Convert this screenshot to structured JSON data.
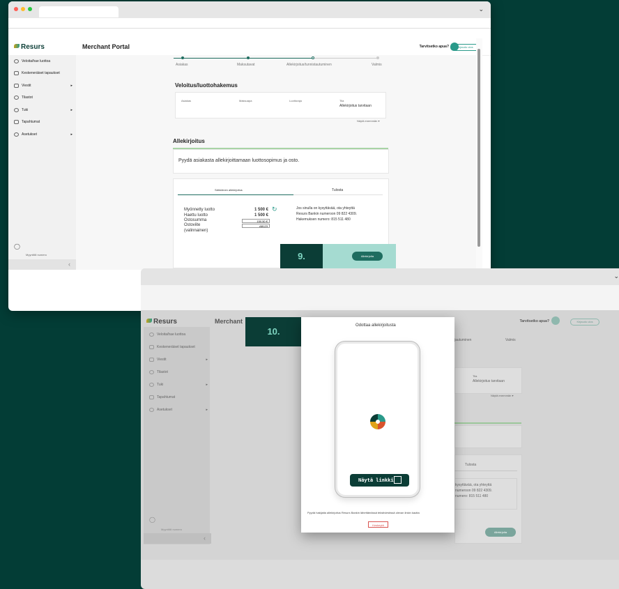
{
  "window1": {
    "brand": "Resurs",
    "portal_title": "Merchant Portal",
    "help_text": "Tarvitsetko apua?",
    "logout_label": "Kirjaudu ulos",
    "sidebar": {
      "items": [
        {
          "label": "Veloita/hae luottoa",
          "icon": "circle-icon",
          "arrow": ""
        },
        {
          "label": "Keskeneräiset tapaukset",
          "icon": "document-icon",
          "arrow": ""
        },
        {
          "label": "Viestit",
          "icon": "mail-icon",
          "arrow": "▸"
        },
        {
          "label": "Tilastot",
          "icon": "chart-icon",
          "arrow": ""
        },
        {
          "label": "Tuki",
          "icon": "chat-icon",
          "arrow": "▸"
        },
        {
          "label": "Tapahtumat",
          "icon": "building-icon",
          "arrow": ""
        },
        {
          "label": "Asetukset",
          "icon": "gear-icon",
          "arrow": "▸"
        }
      ],
      "profile_label": "Myyntitili numero"
    },
    "steps": [
      "Asiakas",
      "Maksutavat",
      "Allekirjoitus/tunnistautuminen",
      "Valmis"
    ],
    "application": {
      "title": "Veloitus/luottohakemus",
      "headers": [
        "Asiakas",
        "Maksuapa",
        "Luottoraja",
        "Tila"
      ],
      "status_value": "Allekirjoitus tarvitaan",
      "show_more": "Näytä enemmän ▾"
    },
    "signature": {
      "title": "Allekirjoitus",
      "instruction": "Pyydä asiakasta allekirjoittamaan luottosopimus ja osto.",
      "tabs": [
        "Sähköinen allekirjoitus",
        "Tulosta"
      ],
      "rows": [
        {
          "label": "Myönnetty luotto",
          "value": "1 500 €"
        },
        {
          "label": "Haettu luotto",
          "value": "1 500 €"
        },
        {
          "label": "Ostosumma",
          "value": "150.50 €"
        },
        {
          "label": "Ostoviite",
          "value": "AB123"
        },
        {
          "label": "(valinnainen)",
          "value": ""
        }
      ],
      "info_lines": [
        "Jos sinulla on kysyttävää, ota yhteyttä",
        "Resurs Bankin numeroon 09 822 4309.",
        "Hakemuksen numero: 815 511 480"
      ],
      "sign_button": "Allekirjoita"
    },
    "callout": "9."
  },
  "window2": {
    "brand": "Resurs",
    "portal_title": "Merchant",
    "help_text": "Tarvitsetko apua?",
    "logout_label": "Kirjaudu ulos",
    "sidebar_items": [
      "Veloita/hae luottoa",
      "Keskeneräiset tapaukset",
      "Viestit",
      "Tilastot",
      "Tuki",
      "Tapahtumat",
      "Asetukset"
    ],
    "profile_label": "Myyntitili numero",
    "bg_step_labels": [
      "jautuminen",
      "Valmis"
    ],
    "bg_status_label": "Tila",
    "bg_status_value": "Allekirjoitus tarvitaan",
    "bg_show_more": "Näytä enemmän ▾",
    "bg_tab": "Tulosta",
    "bg_info_lines": [
      "kysyttävää, ota yhteyttä",
      "numeroon 09 822 4309.",
      "numero: 815 511 480"
    ],
    "bg_sign_button": "Allekirjoita",
    "modal": {
      "title": "Odottaa allekirjoitusta",
      "link_button": "Näytä linkki",
      "instruction": "Pyydä hakijalta allekirjoitus Resurs Bankin lähettämässä tekstiviestissä olevan linkin kautta",
      "cancel_button": "Keskeytä"
    },
    "callout": "10."
  },
  "colors": {
    "dark_green": "#0b3d36",
    "accent": "#1f6d60",
    "teal": "#2a9a8a",
    "callout_text": "#7fd6c2",
    "highlight": "#a5dbd1"
  }
}
